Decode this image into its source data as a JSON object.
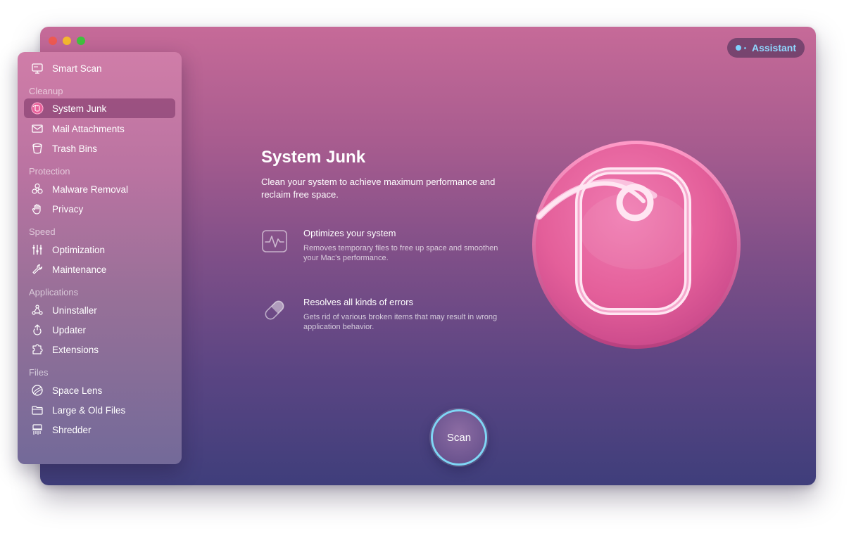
{
  "assistant": {
    "label": "Assistant"
  },
  "sidebar": {
    "smart_scan": "Smart Scan",
    "sections": {
      "cleanup": "Cleanup",
      "protection": "Protection",
      "speed": "Speed",
      "applications": "Applications",
      "files": "Files"
    },
    "items": {
      "system_junk": "System Junk",
      "mail_attachments": "Mail Attachments",
      "trash_bins": "Trash Bins",
      "malware_removal": "Malware Removal",
      "privacy": "Privacy",
      "optimization": "Optimization",
      "maintenance": "Maintenance",
      "uninstaller": "Uninstaller",
      "updater": "Updater",
      "extensions": "Extensions",
      "space_lens": "Space Lens",
      "large_old_files": "Large & Old Files",
      "shredder": "Shredder"
    },
    "active_item": "system_junk"
  },
  "main": {
    "title": "System Junk",
    "description": "Clean your system to achieve maximum performance and reclaim free space.",
    "features": [
      {
        "title": "Optimizes your system",
        "description": "Removes temporary files to free up space and smoothen your Mac's performance.",
        "icon": "activity-monitor-icon"
      },
      {
        "title": "Resolves all kinds of errors",
        "description": "Gets rid of various broken items that may result in wrong application behavior.",
        "icon": "pill-icon"
      }
    ],
    "scan_label": "Scan"
  },
  "colors": {
    "accent_cyan": "#7fd6f5",
    "hero_pink": "#e8609a",
    "window_top": "#c66a98",
    "window_bottom": "#3f3e7b"
  }
}
